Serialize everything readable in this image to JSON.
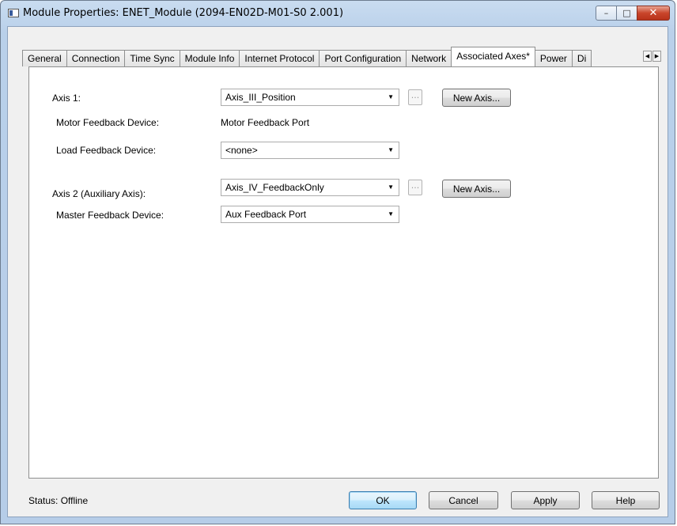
{
  "window": {
    "title": "Module Properties: ENET_Module (2094-EN02D-M01-S0 2.001)",
    "controls": {
      "minimize": "–",
      "maximize": "□",
      "close": "✕"
    }
  },
  "tabs": [
    {
      "label": "General"
    },
    {
      "label": "Connection"
    },
    {
      "label": "Time Sync"
    },
    {
      "label": "Module Info"
    },
    {
      "label": "Internet Protocol"
    },
    {
      "label": "Port Configuration"
    },
    {
      "label": "Network"
    },
    {
      "label": "Associated Axes*",
      "active": true
    },
    {
      "label": "Power"
    },
    {
      "label": "Di"
    }
  ],
  "form": {
    "axis1_label": "Axis 1:",
    "axis1_value": "Axis_III_Position",
    "motor_feedback_label": "Motor Feedback Device:",
    "motor_feedback_value": "Motor Feedback Port",
    "load_feedback_label": "Load Feedback Device:",
    "load_feedback_value": "<none>",
    "axis2_label": "Axis 2  (Auxiliary Axis):",
    "axis2_value": "Axis_IV_FeedbackOnly",
    "master_feedback_label": "Master Feedback Device:",
    "master_feedback_value": "Aux Feedback Port",
    "ellipsis": "...",
    "new_axis": "New Axis..."
  },
  "status": {
    "text": "Status:  Offline"
  },
  "buttons": {
    "ok": "OK",
    "cancel": "Cancel",
    "apply": "Apply",
    "help": "Help"
  }
}
